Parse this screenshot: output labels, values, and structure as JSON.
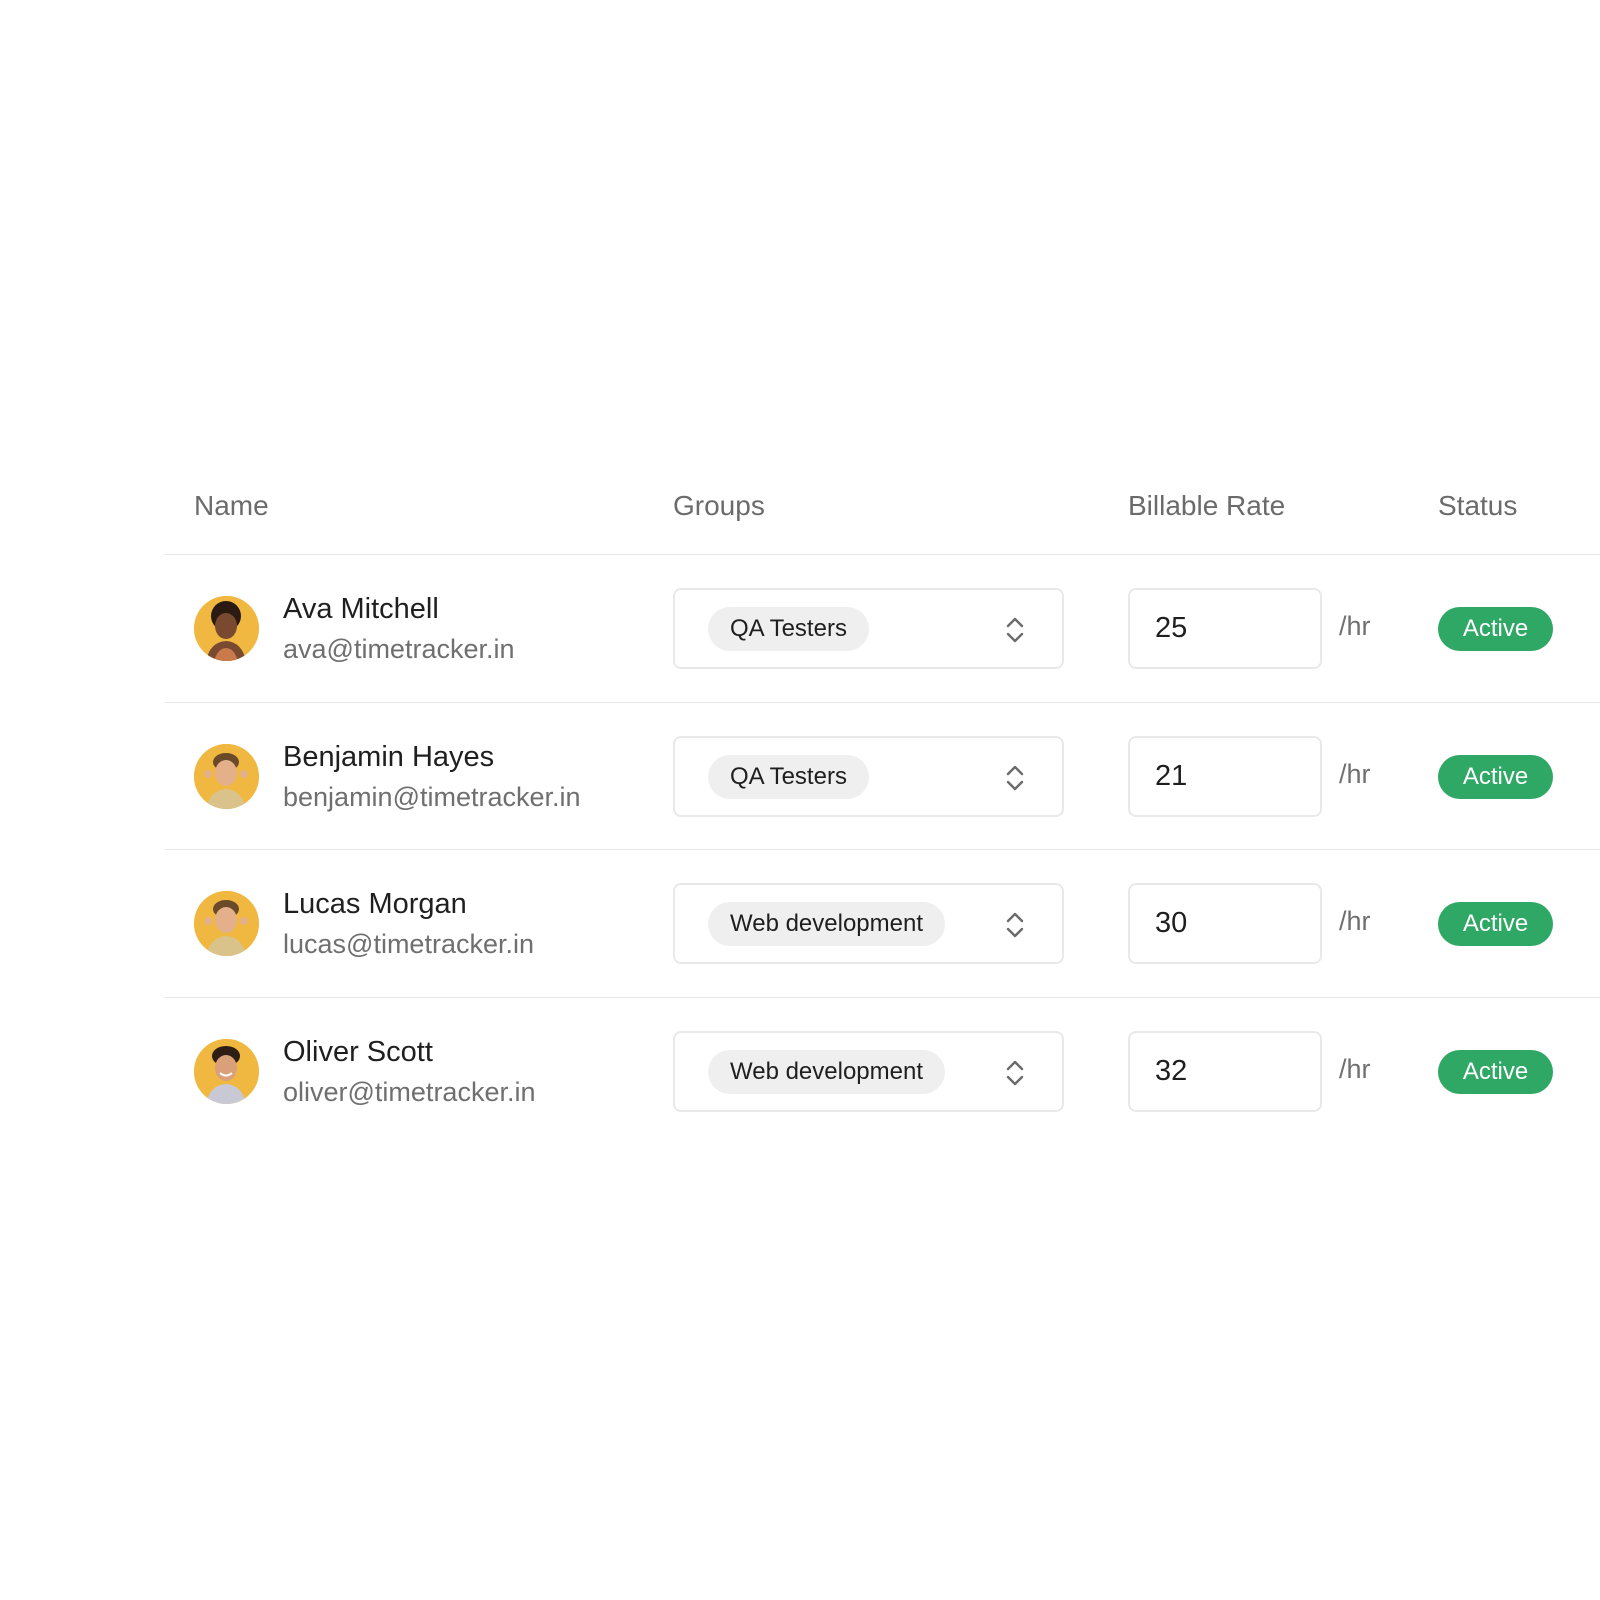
{
  "table": {
    "headers": {
      "name": "Name",
      "groups": "Groups",
      "billable_rate": "Billable Rate",
      "status": "Status"
    },
    "rate_unit": "/hr",
    "rows": [
      {
        "name": "Ava Mitchell",
        "email": "ava@timetracker.in",
        "group": "QA Testers",
        "rate": "25",
        "status": "Active",
        "avatar": "woman-avatar"
      },
      {
        "name": "Benjamin Hayes",
        "email": "benjamin@timetracker.in",
        "group": "QA Testers",
        "rate": "21",
        "status": "Active",
        "avatar": "man-avatar"
      },
      {
        "name": "Lucas Morgan",
        "email": "lucas@timetracker.in",
        "group": "Web development",
        "rate": "30",
        "status": "Active",
        "avatar": "man-avatar"
      },
      {
        "name": "Oliver Scott",
        "email": "oliver@timetracker.in",
        "group": "Web development",
        "rate": "32",
        "status": "Active",
        "avatar": "man-avatar"
      }
    ]
  },
  "colors": {
    "avatar_bg": "#f0b840",
    "status_active": "#2fa866",
    "chip_bg": "#efefef",
    "border": "#e9e9e9"
  }
}
